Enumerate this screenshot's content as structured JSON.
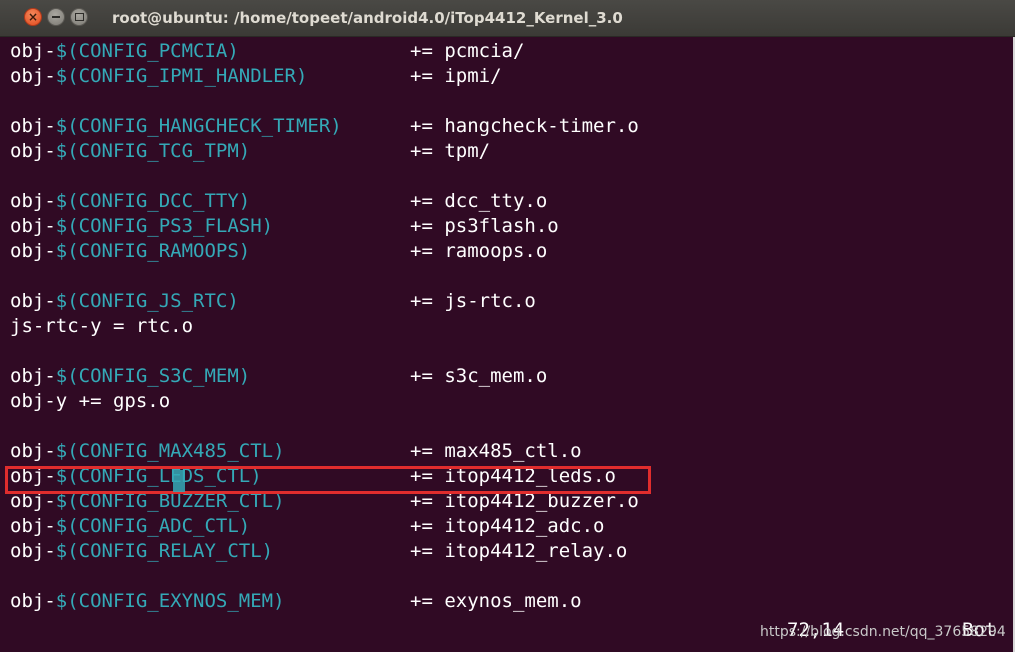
{
  "window": {
    "title": "root@ubuntu: /home/topeet/android4.0/iTop4412_Kernel_3.0",
    "buttons": {
      "close": "×",
      "minimize": "minimize",
      "maximize": "maximize"
    }
  },
  "colors": {
    "background": "#300a24",
    "variable": "#34a9b7",
    "text": "#ffffff",
    "highlight_box": "#e02d2d"
  },
  "lines": [
    {
      "prefix": "obj-",
      "var": "$(CONFIG_PCMCIA)",
      "op": "+= pcmcia/"
    },
    {
      "prefix": "obj-",
      "var": "$(CONFIG_IPMI_HANDLER)",
      "op": "+= ipmi/"
    },
    {
      "prefix": "",
      "var": "",
      "op": ""
    },
    {
      "prefix": "obj-",
      "var": "$(CONFIG_HANGCHECK_TIMER)",
      "op": "+= hangcheck-timer.o"
    },
    {
      "prefix": "obj-",
      "var": "$(CONFIG_TCG_TPM)",
      "op": "+= tpm/"
    },
    {
      "prefix": "",
      "var": "",
      "op": ""
    },
    {
      "prefix": "obj-",
      "var": "$(CONFIG_DCC_TTY)",
      "op": "+= dcc_tty.o"
    },
    {
      "prefix": "obj-",
      "var": "$(CONFIG_PS3_FLASH)",
      "op": "+= ps3flash.o"
    },
    {
      "prefix": "obj-",
      "var": "$(CONFIG_RAMOOPS)",
      "op": "+= ramoops.o"
    },
    {
      "prefix": "",
      "var": "",
      "op": ""
    },
    {
      "prefix": "obj-",
      "var": "$(CONFIG_JS_RTC)",
      "op": "+= js-rtc.o"
    },
    {
      "prefix": "js-rtc-y = rtc.o",
      "var": "",
      "op": ""
    },
    {
      "prefix": "",
      "var": "",
      "op": ""
    },
    {
      "prefix": "obj-",
      "var": "$(CONFIG_S3C_MEM)",
      "op": "+= s3c_mem.o"
    },
    {
      "prefix": "obj-y += gps.o",
      "var": "",
      "op": ""
    },
    {
      "prefix": "",
      "var": "",
      "op": ""
    },
    {
      "prefix": "obj-",
      "var": "$(CONFIG_MAX485_CTL)",
      "op": "+= max485_ctl.o"
    },
    {
      "prefix": "obj-",
      "var": "$(CONFIG_LEDS_CTL)",
      "op": "+= itop4412_leds.o"
    },
    {
      "prefix": "obj-",
      "var": "$(CONFIG_BUZZER_CTL)",
      "op": "+= itop4412_buzzer.o"
    },
    {
      "prefix": "obj-",
      "var": "$(CONFIG_ADC_CTL)",
      "op": "+= itop4412_adc.o"
    },
    {
      "prefix": "obj-",
      "var": "$(CONFIG_RELAY_CTL)",
      "op": "+= itop4412_relay.o"
    },
    {
      "prefix": "",
      "var": "",
      "op": ""
    },
    {
      "prefix": "obj-",
      "var": "$(CONFIG_EXYNOS_MEM)",
      "op": "+= exynos_mem.o"
    }
  ],
  "status": {
    "position": "72,14",
    "scroll": "Bot"
  },
  "watermark": "https://blog.csdn.net/qq_37658294"
}
